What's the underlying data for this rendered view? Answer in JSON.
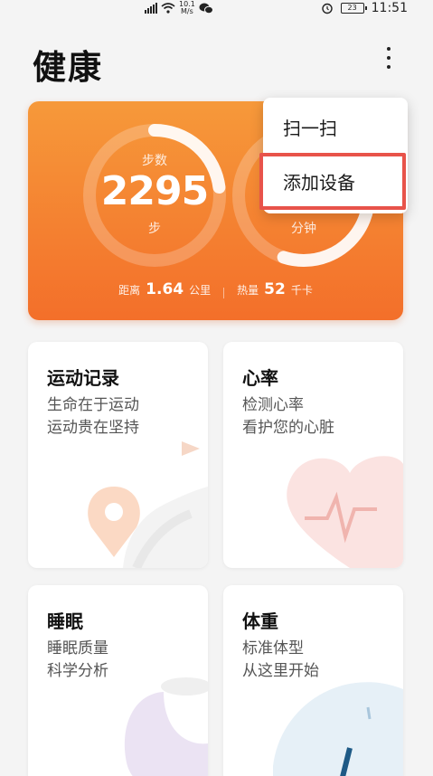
{
  "status_bar": {
    "network_speed_top": "10.1",
    "network_speed_unit": "M/s",
    "battery": "23",
    "time": "11:51"
  },
  "header": {
    "title": "健康",
    "more_icon": "more-vertical-icon"
  },
  "activity_card": {
    "steps_label": "步数",
    "steps_value": "2295",
    "steps_unit": "步",
    "minutes_unit": "分钟",
    "distance_label": "距离",
    "distance_value": "1.64",
    "distance_unit": "公里",
    "calories_label": "热量",
    "calories_value": "52",
    "calories_unit": "千卡",
    "steps_progress": 0.23,
    "minutes_progress": 0.55,
    "gradient_top": "#f6993a",
    "gradient_bottom": "#f36f2a"
  },
  "popup_menu": {
    "items": [
      {
        "label": "扫一扫"
      },
      {
        "label": "添加设备"
      }
    ],
    "highlight_color": "#e8534a"
  },
  "tiles": [
    {
      "title": "运动记录",
      "line1": "生命在于运动",
      "line2": "运动贵在坚持",
      "icon": "location-pin-icon"
    },
    {
      "title": "心率",
      "line1": "检测心率",
      "line2": "看护您的心脏",
      "icon": "heart-pulse-icon"
    },
    {
      "title": "睡眠",
      "line1": "睡眠质量",
      "line2": "科学分析",
      "icon": "moon-icon"
    },
    {
      "title": "体重",
      "line1": "标准体型",
      "line2": "从这里开始",
      "icon": "scale-gauge-icon"
    }
  ]
}
